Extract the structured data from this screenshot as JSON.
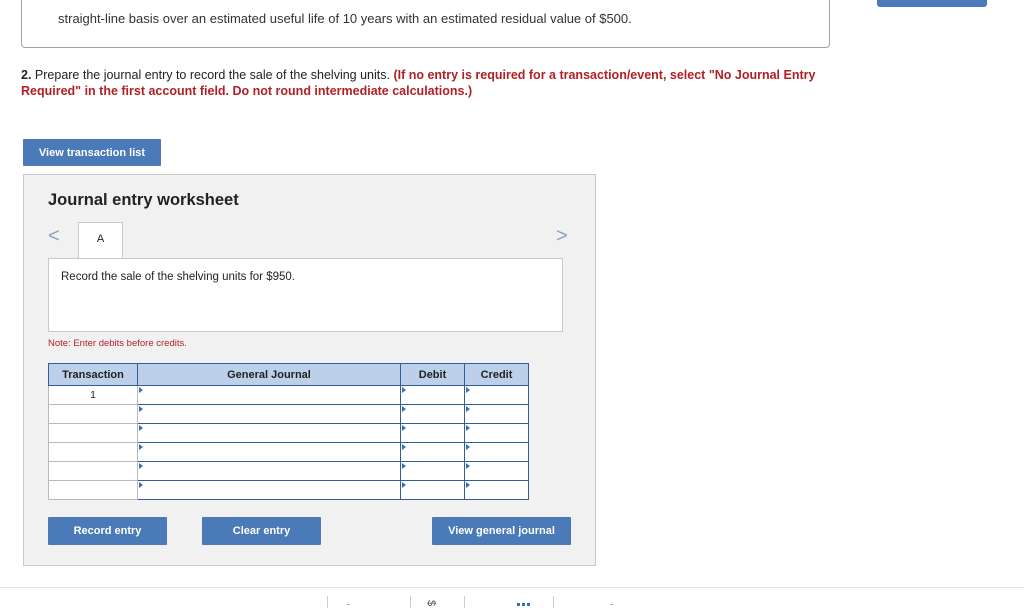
{
  "context": {
    "text": "straight-line basis over an estimated useful life of 10 years with an estimated residual value of $500."
  },
  "question": {
    "number": "2.",
    "text": " Prepare the journal entry to record the sale of the shelving units. ",
    "instruction": "(If no entry is required for a transaction/event, select \"No Journal Entry Required\" in the first account field. Do not round intermediate calculations.)"
  },
  "buttons": {
    "view_transaction_list": "View transaction list",
    "record_entry": "Record entry",
    "clear_entry": "Clear entry",
    "view_general_journal": "View general journal"
  },
  "worksheet": {
    "title": "Journal entry worksheet",
    "tab_label": "A",
    "prev": "<",
    "next": ">",
    "description": "Record the sale of the shelving units for $950.",
    "note": "Note: Enter debits before credits."
  },
  "table": {
    "headers": {
      "transaction": "Transaction",
      "general_journal": "General Journal",
      "debit": "Debit",
      "credit": "Credit"
    },
    "rows": [
      {
        "transaction": "1",
        "account": "",
        "debit": "",
        "credit": ""
      },
      {
        "transaction": "",
        "account": "",
        "debit": "",
        "credit": ""
      },
      {
        "transaction": "",
        "account": "",
        "debit": "",
        "credit": ""
      },
      {
        "transaction": "",
        "account": "",
        "debit": "",
        "credit": ""
      },
      {
        "transaction": "",
        "account": "",
        "debit": "",
        "credit": ""
      },
      {
        "transaction": "",
        "account": "",
        "debit": "",
        "credit": ""
      }
    ]
  },
  "toolbar": {
    "dollar_icon": "$"
  },
  "colors": {
    "accent": "#4a7ab8",
    "instruction_red": "#b21f24",
    "header_bg": "#bcd0ea"
  }
}
